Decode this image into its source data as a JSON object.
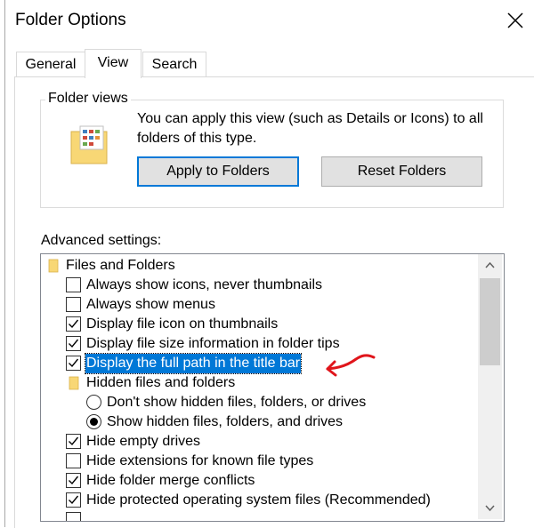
{
  "window": {
    "title": "Folder Options"
  },
  "tabs": [
    {
      "label": "General",
      "active": false
    },
    {
      "label": "View",
      "active": true
    },
    {
      "label": "Search",
      "active": false
    }
  ],
  "folder_views": {
    "group_label": "Folder views",
    "description": "You can apply this view (such as Details or Icons) to all folders of this type.",
    "apply_button": "Apply to Folders",
    "reset_button": "Reset Folders"
  },
  "advanced": {
    "label": "Advanced settings:",
    "items": [
      {
        "type": "folder",
        "label": "Files and Folders"
      },
      {
        "type": "checkbox",
        "label": "Always show icons, never thumbnails",
        "checked": false
      },
      {
        "type": "checkbox",
        "label": "Always show menus",
        "checked": false
      },
      {
        "type": "checkbox",
        "label": "Display file icon on thumbnails",
        "checked": true
      },
      {
        "type": "checkbox",
        "label": "Display file size information in folder tips",
        "checked": true
      },
      {
        "type": "checkbox",
        "label": "Display the full path in the title bar",
        "checked": true,
        "selected": true
      },
      {
        "type": "folder",
        "label": "Hidden files and folders"
      },
      {
        "type": "radio",
        "label": "Don't show hidden files, folders, or drives",
        "checked": false
      },
      {
        "type": "radio",
        "label": "Show hidden files, folders, and drives",
        "checked": true
      },
      {
        "type": "checkbox",
        "label": "Hide empty drives",
        "checked": true
      },
      {
        "type": "checkbox",
        "label": "Hide extensions for known file types",
        "checked": false
      },
      {
        "type": "checkbox",
        "label": "Hide folder merge conflicts",
        "checked": true
      },
      {
        "type": "checkbox",
        "label": "Hide protected operating system files (Recommended)",
        "checked": true
      }
    ]
  },
  "colors": {
    "selection": "#0078d7",
    "annotation_arrow": "#e0151b",
    "folder": "#f8d775"
  },
  "icons": {
    "close": "close-icon",
    "folder": "folder-icon",
    "scroll_up": "chevron-up-icon",
    "scroll_down": "chevron-down-icon"
  }
}
